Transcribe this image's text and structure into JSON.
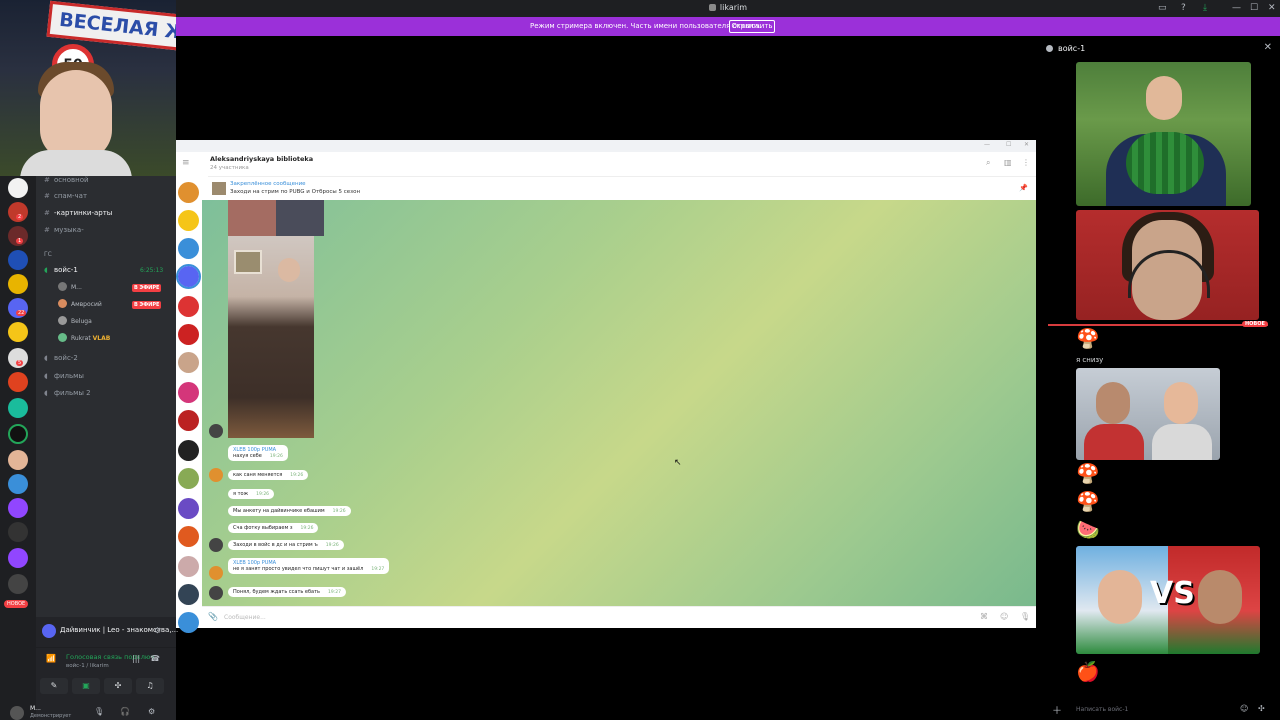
{
  "window": {
    "title": "likarim",
    "controls": [
      "▭",
      "?",
      "⤓",
      "—",
      "☐",
      "✕"
    ]
  },
  "banner": {
    "text": "Режим стримера включен. Часть имени пользователя скрыта.",
    "button": "Отключить",
    "close": "✕"
  },
  "webcam": {
    "sign_text": "ВЕСЕЛАЯ ЖИЗ",
    "speed_sign": "50"
  },
  "servers": {
    "badges": [
      "2",
      "1",
      "22",
      "5"
    ],
    "new_label": "НОВОЕ"
  },
  "sidebar": {
    "channels": [
      {
        "label": "основной",
        "type": "text"
      },
      {
        "label": "спам-чат",
        "type": "text"
      },
      {
        "label": "-картинки-арты",
        "type": "text"
      },
      {
        "label": "музыка-",
        "type": "text"
      }
    ],
    "category_gs": "ГС",
    "voice_active": {
      "label": "войс-1",
      "timer": "6:25:13"
    },
    "voice_users": [
      {
        "name": "М...",
        "live": "В ЭФИРЕ"
      },
      {
        "name": "Амвросий",
        "live": "В ЭФИРЕ"
      },
      {
        "name": "Beluga",
        "live": ""
      },
      {
        "name": "Rukrat",
        "live": "",
        "tag": "VLAB"
      }
    ],
    "voice_channels": [
      "войс-2",
      "фильмы",
      "фильмы 2"
    ],
    "activity": {
      "name": "Дайвинчик | Leo - знакомства,..."
    },
    "voice_panel": {
      "status": "Голосовая связь подключ",
      "sub": "войс-1 / likarim"
    },
    "user": {
      "name": "М...",
      "status": "Демонстрирует"
    }
  },
  "telegram": {
    "chat_title": "Aleksandriyskaya biblioteka",
    "members": "24 участника",
    "pinned_label": "Закреплённое сообщение",
    "pinned_text": "Заходи на стрим по PUBG и Отбросы 5 сезон",
    "messages": [
      {
        "from": "XLEB 100p PUMA",
        "text": "нахуя себе",
        "time": "19:26"
      },
      {
        "from": "",
        "text": "как саня меняется",
        "time": "19:26"
      },
      {
        "from": "",
        "text": "я тож",
        "time": "19:26"
      },
      {
        "from": "",
        "text": "Мы анкету на дайвинчике ебашим",
        "time": "19:26"
      },
      {
        "from": "",
        "text": "Сча фотку выбираем з",
        "time": "19:26"
      },
      {
        "from": "",
        "text": "Заходи в войс в дс и на стрим ъ",
        "time": "19:26"
      },
      {
        "from": "XLEB 100p PUMA",
        "text": "не я занят просто увидел что пишут чат и зашёл",
        "time": "19:27"
      },
      {
        "from": "",
        "text": "Понял, будем ждать ссать ебать",
        "time": "19:27"
      }
    ],
    "input_placeholder": "Сообщение..."
  },
  "voice_view": {
    "channel": "войс-1",
    "new_label": "НОВОЕ",
    "caption": "я снизу",
    "vs_text": "VS",
    "composer_placeholder": "Написать войс-1"
  },
  "colors": {
    "banner": "#9b30d9",
    "live": "#f23f43",
    "connected": "#23a559",
    "telegram_link": "#3a8fd9"
  }
}
